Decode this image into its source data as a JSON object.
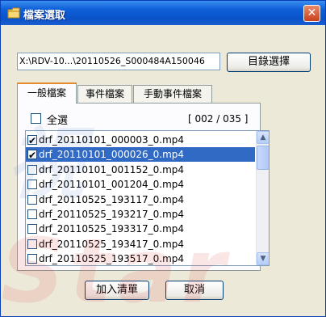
{
  "window": {
    "title": "檔案選取",
    "close_glyph": "✕",
    "title_icon": "folder-icon",
    "close_icon": "close-icon"
  },
  "path": {
    "value": "X:\\RDV-10...\\20110526_S000484A150046",
    "browse_label": "目錄選擇"
  },
  "tabs": [
    {
      "label": "一般檔案",
      "active": true
    },
    {
      "label": "事件檔案",
      "active": false
    },
    {
      "label": "手動事件檔案",
      "active": false
    }
  ],
  "select_all": {
    "label": "全選",
    "checked": false
  },
  "count": "[ 002 / 035 ]",
  "files": [
    {
      "name": "drf_20110101_000003_0.mp4",
      "checked": true,
      "selected": false
    },
    {
      "name": "drf_20110101_000026_0.mp4",
      "checked": true,
      "selected": true
    },
    {
      "name": "drf_20110101_001152_0.mp4",
      "checked": false,
      "selected": false
    },
    {
      "name": "drf_20110101_001204_0.mp4",
      "checked": false,
      "selected": false
    },
    {
      "name": "drf_20110525_193117_0.mp4",
      "checked": false,
      "selected": false
    },
    {
      "name": "drf_20110525_193217_0.mp4",
      "checked": false,
      "selected": false
    },
    {
      "name": "drf_20110525_193317_0.mp4",
      "checked": false,
      "selected": false
    },
    {
      "name": "drf_20110525_193417_0.mp4",
      "checked": false,
      "selected": false
    },
    {
      "name": "drf_20110525_193517_0.mp4",
      "checked": false,
      "selected": false
    }
  ],
  "scrollbar": {
    "up_glyph": "▲",
    "down_glyph": "▼"
  },
  "actions": {
    "add_label": "加入清單",
    "cancel_label": "取消"
  },
  "watermark": {
    "top": "視",
    "bottom": "Star"
  },
  "colors": {
    "titlebar": "#0a52c8",
    "selection": "#316ac5",
    "tab_accent": "#e68b2c"
  }
}
